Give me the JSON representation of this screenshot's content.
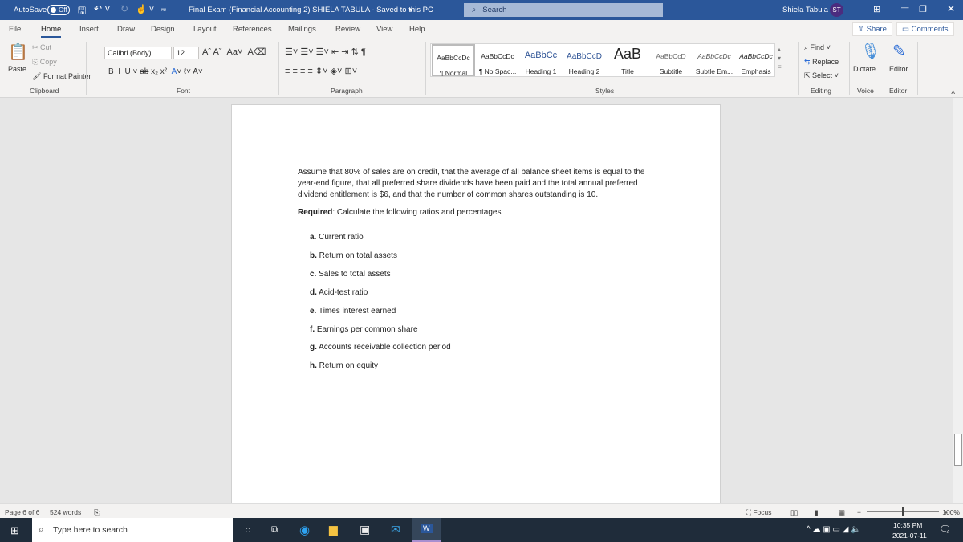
{
  "titlebar": {
    "autosave": "AutoSave",
    "autosave_state": "Off",
    "doc_title": "Final Exam (Financial Accounting 2) SHIELA TABULA  -  Saved to this PC",
    "search_placeholder": "Search",
    "user_name": "Shiela Tabula",
    "user_initials": "ST",
    "accent": "#2b579a"
  },
  "tabs": [
    "File",
    "Home",
    "Insert",
    "Draw",
    "Design",
    "Layout",
    "References",
    "Mailings",
    "Review",
    "View",
    "Help"
  ],
  "share": "Share",
  "comments": "Comments",
  "ribbon": {
    "clipboard": {
      "paste": "Paste",
      "cut": "Cut",
      "copy": "Copy",
      "format_painter": "Format Painter",
      "label": "Clipboard"
    },
    "font": {
      "name": "Calibri (Body)",
      "size": "12",
      "label": "Font"
    },
    "paragraph": {
      "label": "Paragraph"
    },
    "styles": {
      "items": [
        {
          "preview": "AaBbCcDc",
          "name": "¶ Normal"
        },
        {
          "preview": "AaBbCcDc",
          "name": "¶ No Spac..."
        },
        {
          "preview": "AaBbCc",
          "name": "Heading 1"
        },
        {
          "preview": "AaBbCcD",
          "name": "Heading 2"
        },
        {
          "preview": "AaB",
          "name": "Title"
        },
        {
          "preview": "AaBbCcD",
          "name": "Subtitle"
        },
        {
          "preview": "AaBbCcDc",
          "name": "Subtle Em..."
        },
        {
          "preview": "AaBbCcDc",
          "name": "Emphasis"
        }
      ],
      "label": "Styles"
    },
    "editing": {
      "find": "Find",
      "replace": "Replace",
      "select": "Select",
      "label": "Editing"
    },
    "voice": {
      "dictate": "Dictate",
      "label": "Voice"
    },
    "editor": {
      "editor": "Editor",
      "label": "Editor"
    }
  },
  "document": {
    "paragraph": "Assume that 80% of sales are on credit, that the average of all balance sheet items is equal to the year-end figure, that all preferred share dividends have been paid and the total annual preferred dividend entitlement is $6, and that the number of common shares outstanding is 10.",
    "required_label": "Required",
    "required_text": ": Calculate the following ratios and percentages",
    "items": [
      {
        "letter": "a.",
        "text": "Current ratio"
      },
      {
        "letter": "b.",
        "text": "Return on total assets"
      },
      {
        "letter": "c.",
        "text": "Sales to total assets"
      },
      {
        "letter": "d.",
        "text": "Acid-test ratio"
      },
      {
        "letter": "e.",
        "text": "Times interest earned"
      },
      {
        "letter": "f.",
        "text": "Earnings per common share"
      },
      {
        "letter": "g.",
        "text": "Accounts receivable collection period"
      },
      {
        "letter": "h.",
        "text": "Return on equity"
      }
    ]
  },
  "status": {
    "page": "Page 6 of 6",
    "words": "524 words",
    "focus": "Focus",
    "zoom": "100%"
  },
  "taskbar": {
    "search_placeholder": "Type here to search",
    "time": "10:35 PM",
    "date": "2021-07-11"
  }
}
